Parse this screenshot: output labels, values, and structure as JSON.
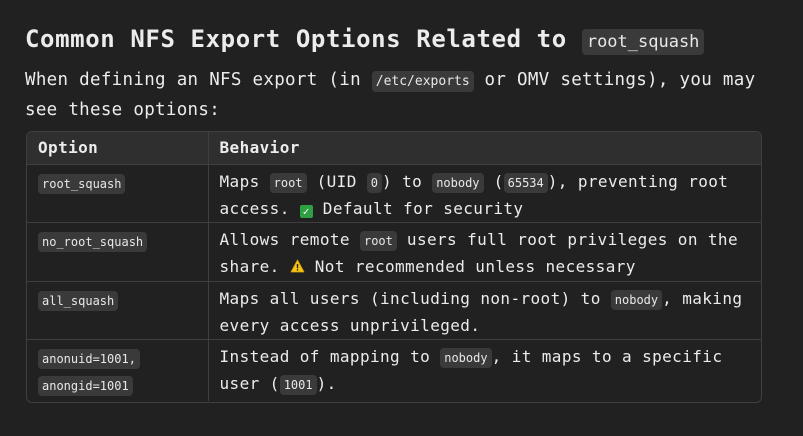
{
  "heading": {
    "text": "Common NFS Export Options Related to ",
    "code": "root_squash"
  },
  "intro": {
    "part1": "When defining an NFS export (in ",
    "code": "/etc/exports",
    "part2": " or OMV settings), you may see these options:"
  },
  "table": {
    "headers": [
      "Option",
      "Behavior"
    ],
    "rows": [
      {
        "option": "root_squash",
        "b1": "Maps ",
        "c1": "root",
        "b2": " (UID ",
        "c2": "0",
        "b3": ") to ",
        "c3": "nobody",
        "b4": " (",
        "c4": "65534",
        "b5": "), preventing root access. ",
        "emoji": "check-mark-icon",
        "b6": " Default for security"
      },
      {
        "option": "no_root_squash",
        "b1": "Allows remote ",
        "c1": "root",
        "b2": " users full root privileges on the share. ",
        "emoji": "warning-icon",
        "b3": " Not recommended unless necessary"
      },
      {
        "option": "all_squash",
        "b1": "Maps all users (including non-root) to ",
        "c1": "nobody",
        "b2": ", making every access unprivileged."
      },
      {
        "option_line1": "anonuid=1001,",
        "option_line2": "anongid=1001",
        "b1": "Instead of mapping to ",
        "c1": "nobody",
        "b2": ", it maps to a specific user (",
        "c2": "1001",
        "b3": ")."
      }
    ]
  },
  "colors": {
    "background": "#212121",
    "text": "#ececec",
    "code_bg": "#3a3a3a",
    "border": "#3f3f3f",
    "header_bg": "#2f2f2f",
    "check_green": "#2ea043",
    "warning_yellow": "#f5c518"
  }
}
